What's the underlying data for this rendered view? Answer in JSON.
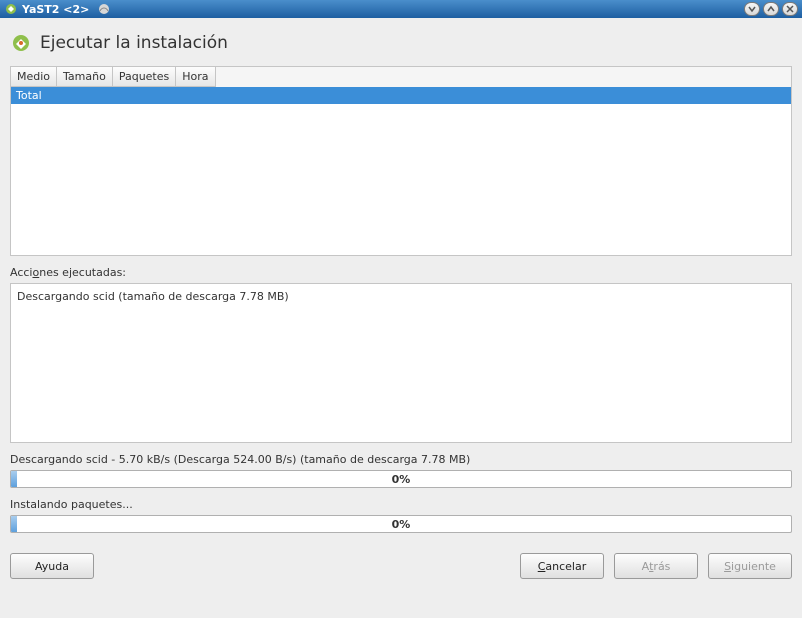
{
  "titlebar": {
    "title": "YaST2 <2>"
  },
  "page": {
    "title": "Ejecutar la instalación"
  },
  "table": {
    "headers": [
      "Medio",
      "Tamaño",
      "Paquetes",
      "Hora"
    ],
    "rows": [
      {
        "cells": [
          "Total",
          "",
          "",
          ""
        ],
        "selected": true
      }
    ]
  },
  "actions": {
    "label_pre": "Acci",
    "label_ul": "o",
    "label_post": "nes ejecutadas:",
    "lines": [
      "Descargando scid (tamaño de descarga 7.78 MB)"
    ]
  },
  "progress1": {
    "label": "Descargando scid - 5.70 kB/s (Descarga  524.00 B/s) (tamaño de descarga 7.78 MB)",
    "percent_text": "0%"
  },
  "progress2": {
    "label": "Instalando paquetes...",
    "percent_text": "0%"
  },
  "buttons": {
    "help": "Ayuda",
    "cancel_ul": "C",
    "cancel_rest": "ancelar",
    "back_pre": "A",
    "back_ul": "t",
    "back_post": "rás",
    "next_ul": "S",
    "next_rest": "iguiente"
  }
}
